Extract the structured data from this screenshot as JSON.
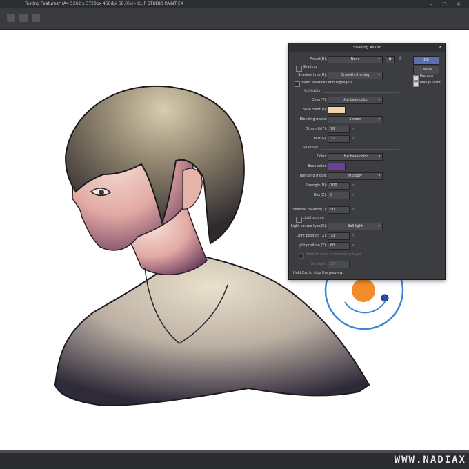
{
  "app": {
    "title": "Testing Features* (A4 5262 x 3720px 450dpi 50.0%) - CLIP STUDIO PAINT EX",
    "window_controls": "–  ▢  ✕"
  },
  "watermark": "WWW.NADIAX",
  "dialog": {
    "title": "Shading Assist",
    "close": "✕",
    "preset_label": "Preset(B):",
    "preset_value": "None",
    "shading_section": "Shading",
    "shadow_type_label": "Shadow type(U):",
    "shadow_type_value": "Smooth shading",
    "invert_label": "Invert shadows and highlights",
    "highlights_section": "Highlights",
    "hl_color_label": "Color(V):",
    "hl_color_value": "Use base color",
    "hl_base_color_label": "Base color(N):",
    "hl_base_color": "#f1d3a8",
    "hl_blend_label": "Blending mode:",
    "hl_blend_value": "Screen",
    "hl_strength_label": "Strength(F):",
    "hl_strength_value": "78",
    "hl_blur_label": "Blur(G):",
    "hl_blur_value": "37",
    "shadows_section": "Shadows",
    "sh_color_label": "Color:",
    "sh_color_value": "Use base color",
    "sh_base_color_label": "Base color:",
    "sh_base_color": "#6a3f94",
    "sh_blend_label": "Blending mode:",
    "sh_blend_value": "Multiply",
    "sh_strength_label": "Strength(D):",
    "sh_strength_value": "100",
    "sh_blur_label": "Blur(Z):",
    "sh_blur_value": "0",
    "shadow_balance_label": "Shadow balance(T):",
    "shadow_balance_value": "50",
    "light_source_section": "Light source",
    "light_type_label": "Light source type(K):",
    "light_type_value": "Ball light",
    "light_x_label": "Light position (X):",
    "light_x_value": "73",
    "light_y_label": "Light position (Y):",
    "light_y_value": "60",
    "refer_label": "Refer to lines on reference layer",
    "strength_label": "Strength:",
    "strength_value": "50",
    "footer": "Hold Esc to stop the preview.",
    "ok_label": "OK",
    "cancel_label": "Cancel",
    "preview_label": "Preview",
    "manipulator_label": "Manipulator"
  }
}
